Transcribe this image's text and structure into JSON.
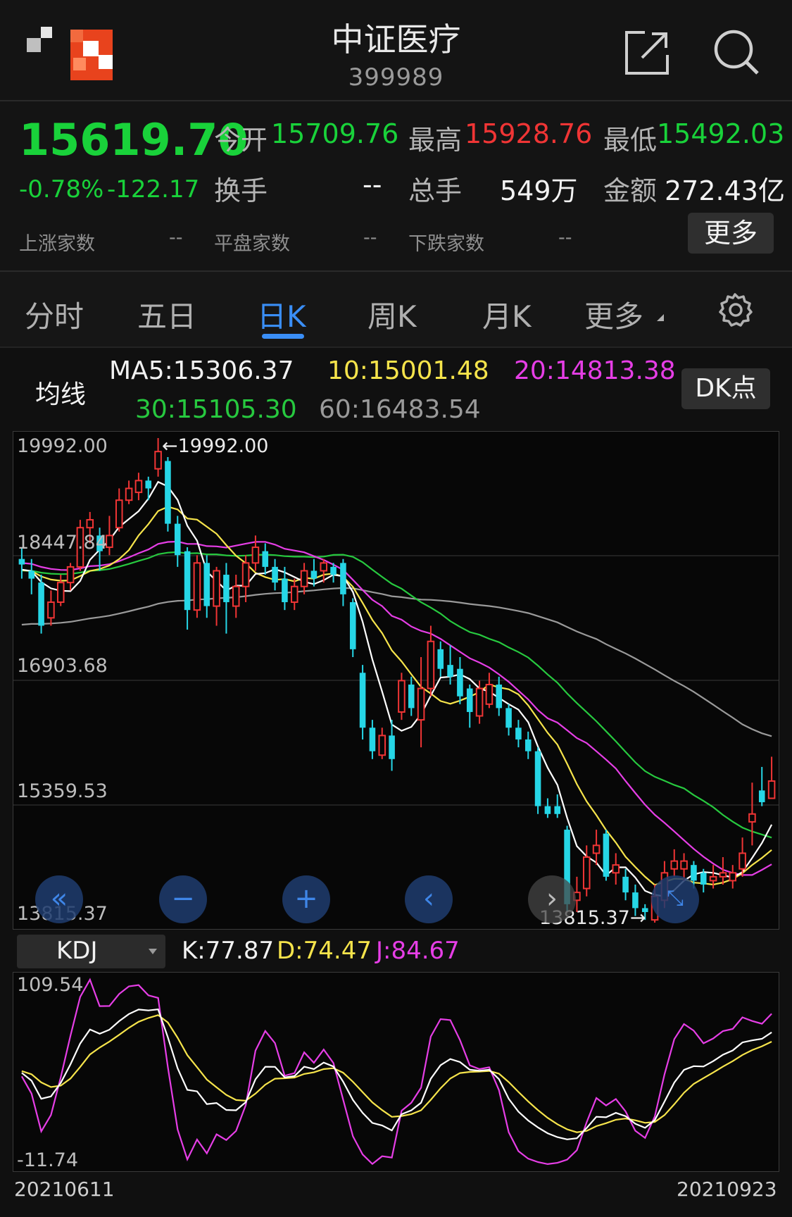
{
  "header": {
    "title": "中证医疗",
    "code": "399989",
    "icons": [
      "app-logo-icon",
      "share-icon",
      "search-icon"
    ]
  },
  "quote": {
    "price": "15619.70",
    "change_pct": "-0.78%",
    "change": "-122.17",
    "open_label": "今开",
    "open": "15709.76",
    "high_label": "最高",
    "high": "15928.76",
    "low_label": "最低",
    "low": "15492.03",
    "turnover_label": "换手",
    "turnover": "--",
    "volume_label": "总手",
    "volume": "549万",
    "amount_label": "金额",
    "amount": "272.43亿",
    "up_label": "上涨家数",
    "up": "--",
    "flat_label": "平盘家数",
    "flat": "--",
    "down_label": "下跌家数",
    "down": "--",
    "more_label": "更多"
  },
  "tabs": [
    {
      "label": "分时"
    },
    {
      "label": "五日"
    },
    {
      "label": "日K",
      "active": true
    },
    {
      "label": "周K"
    },
    {
      "label": "月K"
    },
    {
      "label": "更多"
    }
  ],
  "ma": {
    "label": "均线",
    "ma5": "MA5:15306.37",
    "ma10": "10:15001.48",
    "ma20": "20:14813.38",
    "ma30": "30:15105.30",
    "ma60": "60:16483.54",
    "dk_label": "DK点"
  },
  "colors": {
    "up": "#f03535",
    "down": "#26d6e6",
    "ma5": "#ffffff",
    "ma10": "#f6e44b",
    "ma20": "#e63ee6",
    "ma30": "#27c93f",
    "ma60": "#9a9a9a",
    "accent": "#3a8ef6"
  },
  "price_axis": {
    "ticks": [
      "19992.00",
      "18447.84",
      "16903.68",
      "15359.53",
      "13815.37"
    ],
    "max_marker": "19992.00",
    "min_marker": "13815.37"
  },
  "kdj": {
    "select_label": "KDJ",
    "k": "K:77.87",
    "d": "D:74.47",
    "j": "J:84.67",
    "ticks": [
      "109.54",
      "-11.74"
    ]
  },
  "x_axis": {
    "start": "20210611",
    "end": "20210923"
  },
  "chart_data": {
    "type": "candlestick",
    "price_range": [
      13815.37,
      19992.0
    ],
    "candles": [
      [
        18451,
        18380,
        18600,
        18200
      ],
      [
        18300,
        18200,
        18450,
        18000
      ],
      [
        18150,
        17600,
        18250,
        17500
      ],
      [
        17700,
        17900,
        18050,
        17600
      ],
      [
        17900,
        18150,
        18250,
        17850
      ],
      [
        18150,
        18350,
        18400,
        18050
      ],
      [
        18350,
        18850,
        18950,
        18300
      ],
      [
        18850,
        18950,
        19050,
        18650
      ],
      [
        18750,
        18550,
        18850,
        18300
      ],
      [
        18600,
        18750,
        19000,
        18500
      ],
      [
        18850,
        19200,
        19350,
        18800
      ],
      [
        19200,
        19350,
        19450,
        19150
      ],
      [
        19300,
        19450,
        19550,
        19200
      ],
      [
        19450,
        19350,
        19500,
        19200
      ],
      [
        19600,
        19820,
        19992,
        19500
      ],
      [
        19700,
        18900,
        19750,
        18800
      ],
      [
        18900,
        18500,
        19000,
        18350
      ],
      [
        18550,
        17800,
        18600,
        17550
      ],
      [
        17800,
        18400,
        18500,
        17700
      ],
      [
        18400,
        17850,
        18500,
        17700
      ],
      [
        17850,
        18300,
        18350,
        17600
      ],
      [
        18250,
        17900,
        18400,
        17500
      ],
      [
        17850,
        18100,
        18250,
        17700
      ],
      [
        18100,
        18400,
        18500,
        17900
      ],
      [
        18400,
        18600,
        18750,
        18300
      ],
      [
        18550,
        18350,
        18650,
        18250
      ],
      [
        18350,
        18150,
        18450,
        18050
      ],
      [
        18200,
        17900,
        18350,
        17800
      ],
      [
        17900,
        18100,
        18200,
        17800
      ],
      [
        18100,
        18300,
        18400,
        18000
      ],
      [
        18300,
        18200,
        18450,
        18100
      ],
      [
        18300,
        18400,
        18450,
        18150
      ],
      [
        18350,
        18250,
        18400,
        18150
      ],
      [
        18400,
        18000,
        18450,
        17850
      ],
      [
        17900,
        17300,
        17950,
        17200
      ],
      [
        17000,
        16300,
        17100,
        16150
      ],
      [
        16300,
        16000,
        16400,
        15900
      ],
      [
        15950,
        16200,
        16300,
        15900
      ],
      [
        16200,
        15900,
        16400,
        15750
      ],
      [
        16500,
        16900,
        17000,
        16400
      ],
      [
        16850,
        16550,
        16950,
        16450
      ],
      [
        16400,
        16800,
        17200,
        16050
      ],
      [
        16800,
        17400,
        17600,
        16700
      ],
      [
        17300,
        17050,
        17400,
        16950
      ],
      [
        17100,
        16950,
        17350,
        16850
      ],
      [
        17050,
        16700,
        17200,
        16600
      ],
      [
        16800,
        16500,
        16850,
        16300
      ],
      [
        16450,
        16800,
        16900,
        16350
      ],
      [
        16600,
        16850,
        17000,
        16550
      ],
      [
        16850,
        16550,
        16950,
        16450
      ],
      [
        16550,
        16300,
        16600,
        16200
      ],
      [
        16300,
        16150,
        16400,
        16050
      ],
      [
        16150,
        16000,
        16250,
        15900
      ],
      [
        16000,
        15300,
        16050,
        15200
      ],
      [
        15300,
        15200,
        15400,
        15150
      ],
      [
        15300,
        15200,
        15450,
        15150
      ],
      [
        15000,
        14050,
        15050,
        13950
      ],
      [
        14100,
        14200,
        14400,
        13950
      ],
      [
        14250,
        14650,
        14800,
        14150
      ],
      [
        14700,
        14800,
        15000,
        14550
      ],
      [
        14950,
        14400,
        15000,
        14350
      ],
      [
        14450,
        14550,
        14700,
        14300
      ],
      [
        14400,
        14200,
        14500,
        14100
      ],
      [
        14200,
        14000,
        14300,
        13900
      ],
      [
        14000,
        13950,
        14050,
        13850
      ],
      [
        13850,
        14150,
        14300,
        13815
      ],
      [
        14100,
        14450,
        14600,
        14000
      ],
      [
        14500,
        14600,
        14750,
        14400
      ],
      [
        14500,
        14600,
        14700,
        14350
      ],
      [
        14550,
        14350,
        14600,
        14250
      ],
      [
        14450,
        14300,
        14500,
        14200
      ],
      [
        14350,
        14400,
        14550,
        14250
      ],
      [
        14400,
        14450,
        14650,
        14300
      ],
      [
        14350,
        14450,
        14550,
        14250
      ],
      [
        14500,
        14700,
        14900,
        14400
      ],
      [
        15100,
        15200,
        15600,
        14800
      ],
      [
        15500,
        15350,
        15800,
        15300
      ],
      [
        15400,
        15620,
        15930,
        15490
      ]
    ],
    "kdj_range": [
      -11.74,
      109.54
    ]
  }
}
